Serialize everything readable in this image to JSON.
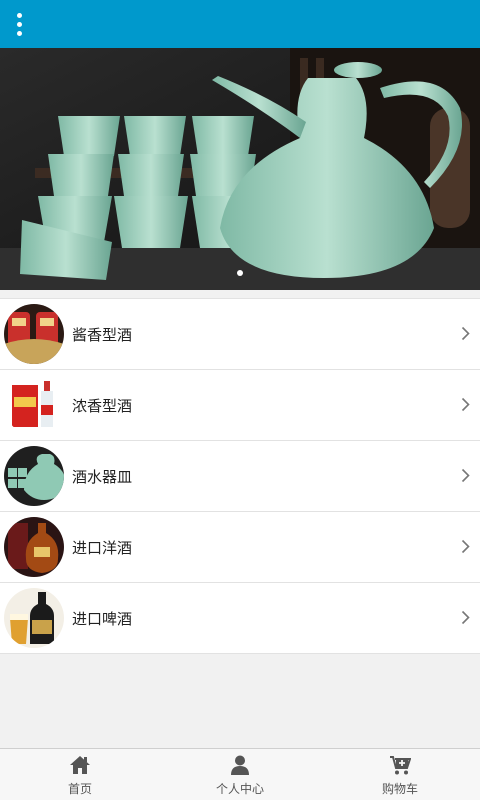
{
  "colors": {
    "header": "#0099cc",
    "tab_icon": "#555555"
  },
  "header": {
    "menu_icon": "more-vertical-icon"
  },
  "banner": {
    "image": "celadon-wine-set-photo",
    "slides": 1,
    "active_slide": 1
  },
  "categories": [
    {
      "label": "酱香型酒",
      "thumb": "maotai-bottles-photo"
    },
    {
      "label": "浓香型酒",
      "thumb": "baijiu-gift-box-photo"
    },
    {
      "label": "酒水器皿",
      "thumb": "celadon-wine-set-photo"
    },
    {
      "label": "进口洋酒",
      "thumb": "cognac-bottle-photo"
    },
    {
      "label": "进口啤酒",
      "thumb": "beer-bottle-glass-photo"
    }
  ],
  "bottom_nav": [
    {
      "label": "首页",
      "icon": "home-icon"
    },
    {
      "label": "个人中心",
      "icon": "user-icon"
    },
    {
      "label": "购物车",
      "icon": "cart-icon"
    }
  ]
}
